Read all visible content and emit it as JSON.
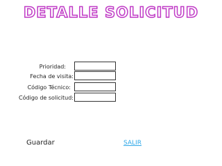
{
  "page": {
    "title": "DETALLE SOLICITUD"
  },
  "form": {
    "fields": [
      {
        "label": "Prioridad:",
        "value": ""
      },
      {
        "label": "Fecha de visita:",
        "value": ""
      },
      {
        "label": "Código Técnico:",
        "value": ""
      },
      {
        "label": "Código de solicitud:",
        "value": ""
      }
    ]
  },
  "actions": {
    "save_label": "Guardar",
    "exit_label": "SALIR"
  },
  "colors": {
    "title_outline": "#c03cc6",
    "link": "#2ea8e8"
  }
}
